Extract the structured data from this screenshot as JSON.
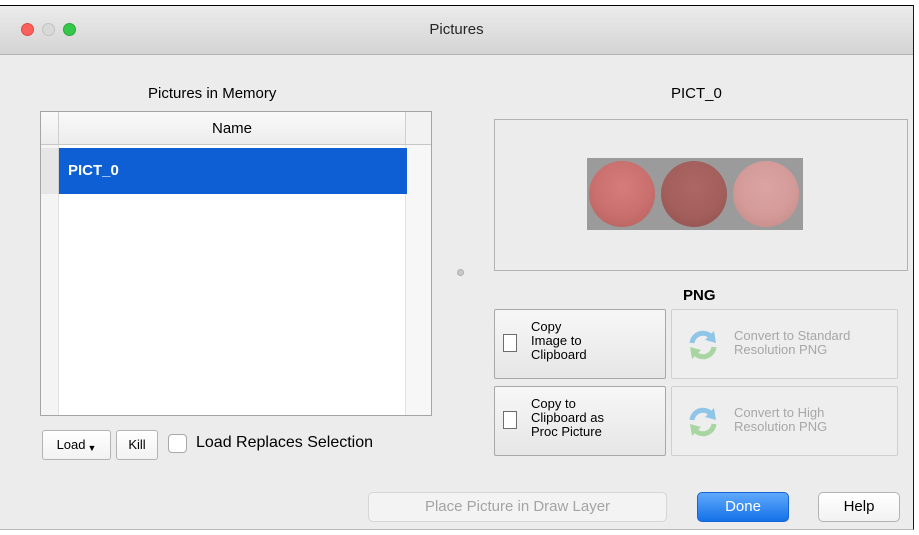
{
  "window": {
    "title": "Pictures"
  },
  "left": {
    "heading": "Pictures in Memory",
    "column_header": "Name",
    "rows": [
      "PICT_0"
    ],
    "load_button": "Load",
    "kill_button": "Kill",
    "load_replaces_label": "Load Replaces Selection",
    "load_replaces_checked": false
  },
  "right": {
    "preview_title": "PICT_0",
    "format_label": "PNG",
    "copy_image_button": "Copy\nImage to\nClipboard",
    "copy_proc_button": "Copy to\nClipboard as\nProc Picture",
    "convert_standard_button": "Convert to Standard\nResolution PNG",
    "convert_high_button": "Convert to High\nResolution PNG"
  },
  "footer": {
    "place_button": "Place Picture in Draw Layer",
    "done_button": "Done",
    "help_button": "Help"
  },
  "colors": {
    "selection": "#0f5fd4",
    "default_button": "#1471e8",
    "circle_left": "#c96f6d",
    "circle_middle": "#a35f5c",
    "circle_right": "#d39a98"
  }
}
